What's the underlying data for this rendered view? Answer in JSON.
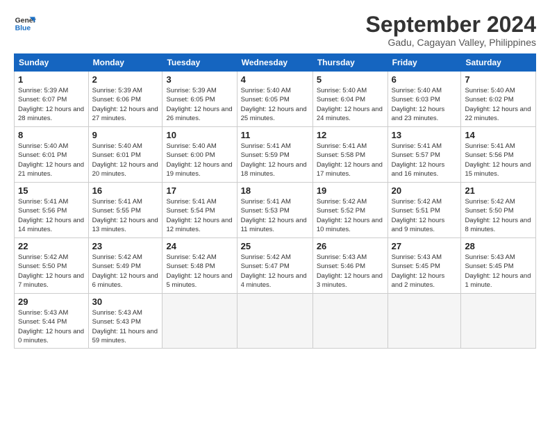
{
  "logo": {
    "line1": "General",
    "line2": "Blue"
  },
  "title": "September 2024",
  "location": "Gadu, Cagayan Valley, Philippines",
  "headers": [
    "Sunday",
    "Monday",
    "Tuesday",
    "Wednesday",
    "Thursday",
    "Friday",
    "Saturday"
  ],
  "weeks": [
    [
      {
        "num": "1",
        "sunrise": "5:39 AM",
        "sunset": "6:07 PM",
        "daylight": "12 hours and 28 minutes."
      },
      {
        "num": "2",
        "sunrise": "5:39 AM",
        "sunset": "6:06 PM",
        "daylight": "12 hours and 27 minutes."
      },
      {
        "num": "3",
        "sunrise": "5:39 AM",
        "sunset": "6:05 PM",
        "daylight": "12 hours and 26 minutes."
      },
      {
        "num": "4",
        "sunrise": "5:40 AM",
        "sunset": "6:05 PM",
        "daylight": "12 hours and 25 minutes."
      },
      {
        "num": "5",
        "sunrise": "5:40 AM",
        "sunset": "6:04 PM",
        "daylight": "12 hours and 24 minutes."
      },
      {
        "num": "6",
        "sunrise": "5:40 AM",
        "sunset": "6:03 PM",
        "daylight": "12 hours and 23 minutes."
      },
      {
        "num": "7",
        "sunrise": "5:40 AM",
        "sunset": "6:02 PM",
        "daylight": "12 hours and 22 minutes."
      }
    ],
    [
      {
        "num": "8",
        "sunrise": "5:40 AM",
        "sunset": "6:01 PM",
        "daylight": "12 hours and 21 minutes."
      },
      {
        "num": "9",
        "sunrise": "5:40 AM",
        "sunset": "6:01 PM",
        "daylight": "12 hours and 20 minutes."
      },
      {
        "num": "10",
        "sunrise": "5:40 AM",
        "sunset": "6:00 PM",
        "daylight": "12 hours and 19 minutes."
      },
      {
        "num": "11",
        "sunrise": "5:41 AM",
        "sunset": "5:59 PM",
        "daylight": "12 hours and 18 minutes."
      },
      {
        "num": "12",
        "sunrise": "5:41 AM",
        "sunset": "5:58 PM",
        "daylight": "12 hours and 17 minutes."
      },
      {
        "num": "13",
        "sunrise": "5:41 AM",
        "sunset": "5:57 PM",
        "daylight": "12 hours and 16 minutes."
      },
      {
        "num": "14",
        "sunrise": "5:41 AM",
        "sunset": "5:56 PM",
        "daylight": "12 hours and 15 minutes."
      }
    ],
    [
      {
        "num": "15",
        "sunrise": "5:41 AM",
        "sunset": "5:56 PM",
        "daylight": "12 hours and 14 minutes."
      },
      {
        "num": "16",
        "sunrise": "5:41 AM",
        "sunset": "5:55 PM",
        "daylight": "12 hours and 13 minutes."
      },
      {
        "num": "17",
        "sunrise": "5:41 AM",
        "sunset": "5:54 PM",
        "daylight": "12 hours and 12 minutes."
      },
      {
        "num": "18",
        "sunrise": "5:41 AM",
        "sunset": "5:53 PM",
        "daylight": "12 hours and 11 minutes."
      },
      {
        "num": "19",
        "sunrise": "5:42 AM",
        "sunset": "5:52 PM",
        "daylight": "12 hours and 10 minutes."
      },
      {
        "num": "20",
        "sunrise": "5:42 AM",
        "sunset": "5:51 PM",
        "daylight": "12 hours and 9 minutes."
      },
      {
        "num": "21",
        "sunrise": "5:42 AM",
        "sunset": "5:50 PM",
        "daylight": "12 hours and 8 minutes."
      }
    ],
    [
      {
        "num": "22",
        "sunrise": "5:42 AM",
        "sunset": "5:50 PM",
        "daylight": "12 hours and 7 minutes."
      },
      {
        "num": "23",
        "sunrise": "5:42 AM",
        "sunset": "5:49 PM",
        "daylight": "12 hours and 6 minutes."
      },
      {
        "num": "24",
        "sunrise": "5:42 AM",
        "sunset": "5:48 PM",
        "daylight": "12 hours and 5 minutes."
      },
      {
        "num": "25",
        "sunrise": "5:42 AM",
        "sunset": "5:47 PM",
        "daylight": "12 hours and 4 minutes."
      },
      {
        "num": "26",
        "sunrise": "5:43 AM",
        "sunset": "5:46 PM",
        "daylight": "12 hours and 3 minutes."
      },
      {
        "num": "27",
        "sunrise": "5:43 AM",
        "sunset": "5:45 PM",
        "daylight": "12 hours and 2 minutes."
      },
      {
        "num": "28",
        "sunrise": "5:43 AM",
        "sunset": "5:45 PM",
        "daylight": "12 hours and 1 minute."
      }
    ],
    [
      {
        "num": "29",
        "sunrise": "5:43 AM",
        "sunset": "5:44 PM",
        "daylight": "12 hours and 0 minutes."
      },
      {
        "num": "30",
        "sunrise": "5:43 AM",
        "sunset": "5:43 PM",
        "daylight": "11 hours and 59 minutes."
      },
      null,
      null,
      null,
      null,
      null
    ]
  ]
}
